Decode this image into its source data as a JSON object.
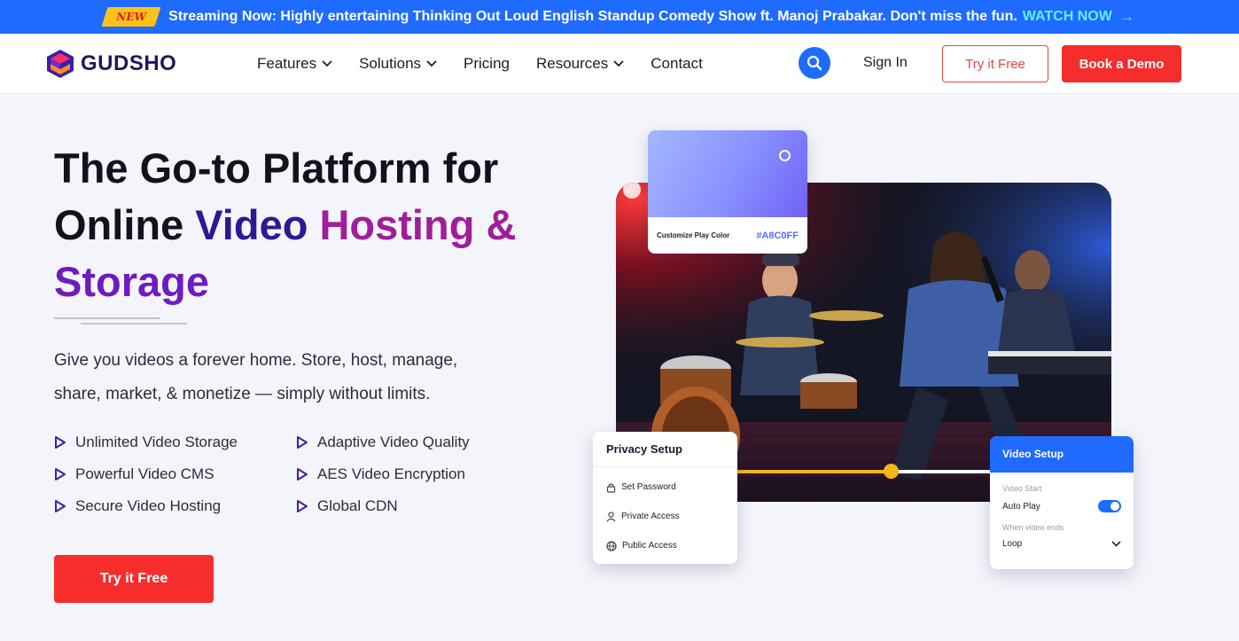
{
  "announcement": {
    "badge": "NEW",
    "message": "Streaming Now: Highly entertaining Thinking Out Loud English Standup Comedy Show ft. Manoj Prabakar. Don't miss the fun.",
    "cta": "WATCH NOW",
    "cta_icon": "arrow-right-icon"
  },
  "header": {
    "brand": "GUDSHO",
    "nav": [
      {
        "label": "Features",
        "dropdown": true
      },
      {
        "label": "Solutions",
        "dropdown": true
      },
      {
        "label": "Pricing",
        "dropdown": false
      },
      {
        "label": "Resources",
        "dropdown": true
      },
      {
        "label": "Contact",
        "dropdown": false
      }
    ],
    "search_icon": "search-icon",
    "sign_in": "Sign In",
    "try_free": "Try it Free",
    "book_demo": "Book a Demo"
  },
  "hero": {
    "title_part1": "The Go-to Platform for",
    "title_part2": "Online",
    "title_part3": "Video",
    "title_part4": "Hosting &",
    "title_part5": "Storage",
    "description": "Give you videos a forever home. Store, host, manage, share, market, & monetize — simply without limits.",
    "features": [
      "Unlimited Video Storage",
      "Adaptive Video Quality",
      "Powerful Video CMS",
      "AES Video Encryption",
      "Secure Video Hosting",
      "Global CDN"
    ],
    "cta": "Try it Free"
  },
  "widgets": {
    "color_card": {
      "label": "Customize Play Color",
      "value": "#A8C0FF"
    },
    "seek_progress": 0.61,
    "privacy": {
      "title": "Privacy Setup",
      "options": [
        {
          "label": "Set Password",
          "icon": "lock-icon"
        },
        {
          "label": "Private Access",
          "icon": "user-icon"
        },
        {
          "label": "Public Access",
          "icon": "globe-icon"
        }
      ]
    },
    "video_setup": {
      "title": "Video Setup",
      "start_label": "Video Start",
      "autoplay_label": "Auto Play",
      "autoplay_on": true,
      "end_label": "When video ends",
      "end_value": "Loop"
    }
  },
  "colors": {
    "brand_blue": "#1f6bff",
    "brand_red": "#f52d2d",
    "accent_yellow": "#f4b41a"
  }
}
